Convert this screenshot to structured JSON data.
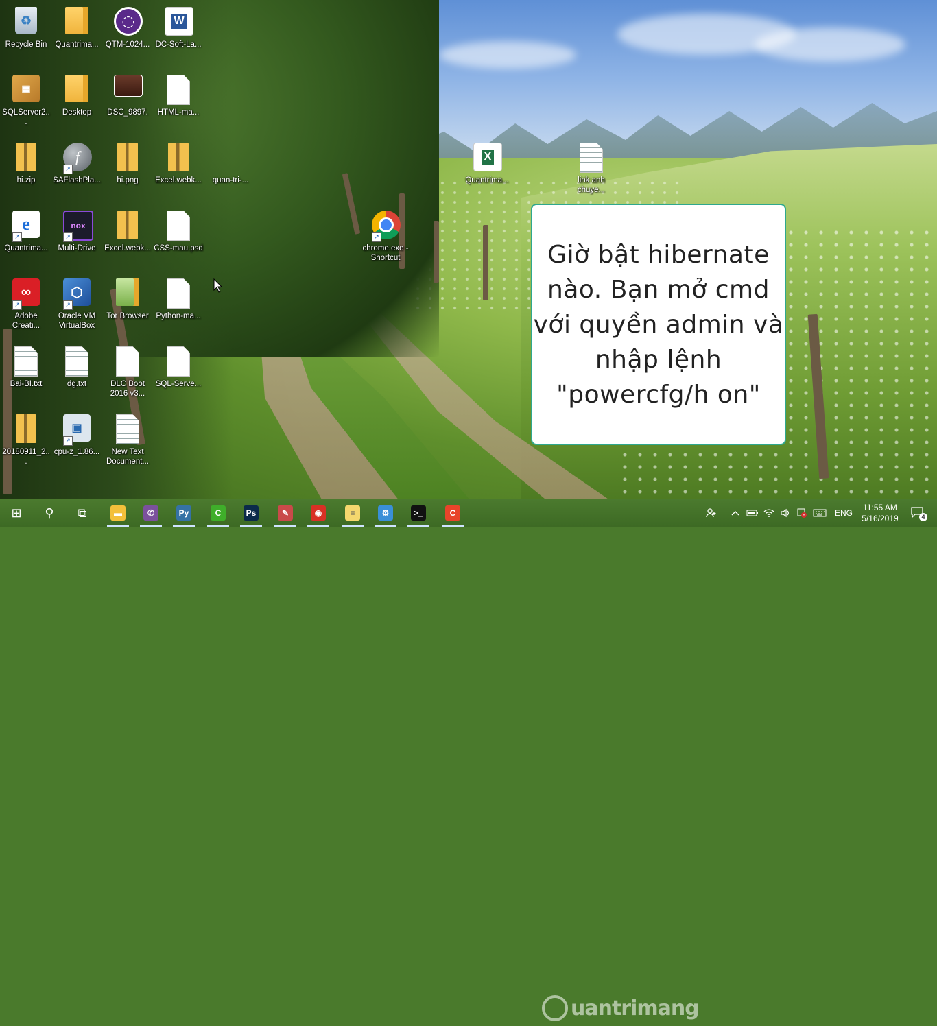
{
  "desktop_icons": [
    {
      "id": "recycle-bin",
      "label": "Recycle Bin",
      "type": "recycle"
    },
    {
      "id": "quantrimang-folder",
      "label": "Quantrima...",
      "type": "docfolder"
    },
    {
      "id": "qtm-1024",
      "label": "QTM-1024...",
      "type": "purple"
    },
    {
      "id": "dc-soft",
      "label": "DC-Soft-La...",
      "type": "word"
    },
    {
      "id": "sqlserver",
      "label": "SQLServer2...",
      "type": "installer"
    },
    {
      "id": "desktop-folder",
      "label": "Desktop",
      "type": "docfolder"
    },
    {
      "id": "dsc-9897",
      "label": "DSC_9897.",
      "type": "photo"
    },
    {
      "id": "html-ma",
      "label": "HTML-ma...",
      "type": "file"
    },
    {
      "id": "hi-zip",
      "label": "hi.zip",
      "type": "zip"
    },
    {
      "id": "saflashplayer",
      "label": "SAFlashPla...",
      "type": "flash"
    },
    {
      "id": "hi-png",
      "label": "hi.png",
      "type": "zip"
    },
    {
      "id": "excel-webk-1",
      "label": "Excel.webk...",
      "type": "zip"
    },
    {
      "id": "quan-tri",
      "label": "quan-tri-...",
      "type": "blank"
    },
    {
      "id": "quantrimang-ie",
      "label": "Quantrima...",
      "type": "edge"
    },
    {
      "id": "multi-drive",
      "label": "Multi-Drive",
      "type": "nox"
    },
    {
      "id": "excel-webk-2",
      "label": "Excel.webk...",
      "type": "zip"
    },
    {
      "id": "css-mau",
      "label": "CSS-mau.psd",
      "type": "file"
    },
    {
      "id": "adobe-creative",
      "label": "Adobe Creati...",
      "type": "adobe"
    },
    {
      "id": "oracle-vm",
      "label": "Oracle VM VirtualBox",
      "type": "vbox"
    },
    {
      "id": "tor-browser",
      "label": "Tor Browser",
      "type": "tor"
    },
    {
      "id": "python-ma",
      "label": "Python-ma...",
      "type": "file"
    },
    {
      "id": "bai-bi",
      "label": "Bai-BI.txt",
      "type": "txt"
    },
    {
      "id": "dg-txt",
      "label": "dg.txt",
      "type": "txt"
    },
    {
      "id": "dlc-boot",
      "label": "DLC Boot 2016 v3...",
      "type": "file"
    },
    {
      "id": "sql-serve",
      "label": "SQL-Serve...",
      "type": "file"
    },
    {
      "id": "zip-20180911",
      "label": "20180911_2...",
      "type": "zip"
    },
    {
      "id": "cpu-z",
      "label": "cpu-z_1.86...",
      "type": "cpuz"
    },
    {
      "id": "new-text-doc",
      "label": "New Text Document...",
      "type": "txt"
    },
    {
      "id": "quantrimang-excel",
      "label": "Quantrima...",
      "type": "excel"
    },
    {
      "id": "link-anh",
      "label": "link anh chuye...",
      "type": "txt"
    },
    {
      "id": "chrome-shortcut",
      "label": "chrome.exe - Shortcut",
      "type": "chrome"
    }
  ],
  "tip_card": {
    "text": "Giờ bật hibernate nào. Bạn mở cmd với quyền admin và nhập lệnh \"powercfg/h on\""
  },
  "watermark": {
    "text": "uantrimang"
  },
  "taskbar": {
    "apps": [
      {
        "id": "start",
        "glyph": "⊞",
        "color": "#ffffff"
      },
      {
        "id": "search",
        "glyph": "⚲",
        "color": "#ffffff"
      },
      {
        "id": "task-view",
        "glyph": "⧉",
        "color": "#ffffff"
      },
      {
        "id": "file-explorer",
        "glyph": "▬",
        "color": "#f3c03b"
      },
      {
        "id": "viber",
        "glyph": "✆",
        "color": "#7b519d"
      },
      {
        "id": "python",
        "glyph": "Py",
        "color": "#3572a5"
      },
      {
        "id": "camtasia",
        "glyph": "C",
        "color": "#3fae2a"
      },
      {
        "id": "photoshop",
        "glyph": "Ps",
        "color": "#0b2a4a"
      },
      {
        "id": "paint",
        "glyph": "✎",
        "color": "#c94a4a"
      },
      {
        "id": "chrome",
        "glyph": "◉",
        "color": "#d93025"
      },
      {
        "id": "notes",
        "glyph": "≡",
        "color": "#f5d76e"
      },
      {
        "id": "network-tool",
        "glyph": "⚙",
        "color": "#3a8fd8"
      },
      {
        "id": "cmd",
        "glyph": ">_",
        "color": "#111111"
      },
      {
        "id": "camtasia-recorder",
        "glyph": "C",
        "color": "#e8442a"
      }
    ],
    "tray": {
      "language": "ENG",
      "time": "11:55 AM",
      "date": "5/16/2019",
      "notification_count": "4"
    }
  }
}
